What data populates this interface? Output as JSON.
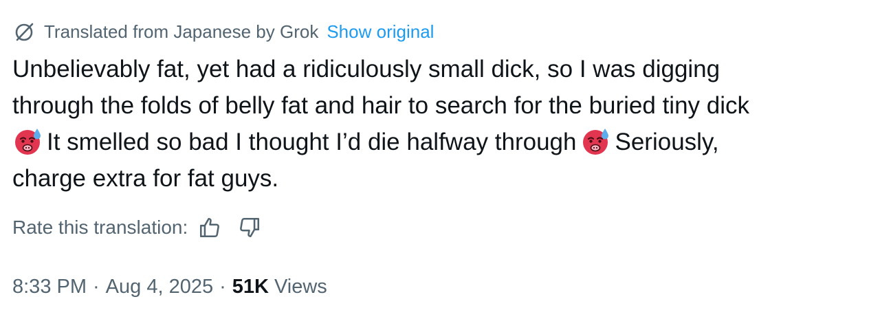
{
  "translation_bar": {
    "label": "Translated from Japanese by Grok",
    "show_original": "Show original",
    "icon": "translate-icon"
  },
  "tweet": {
    "lines": [
      "Unbelievably fat, yet had a ridiculously small dick, so I was digging",
      "through the folds of belly fat and hair to search for the buried tiny dick",
      "It smelled so bad I thought I’d die halfway through",
      "Seriously,",
      "charge extra for fat guys."
    ],
    "emoji": "face-with-sweat-sick-emoji"
  },
  "rating": {
    "label": "Rate this translation:",
    "thumbs_up_icon": "thumbs-up-icon",
    "thumbs_down_icon": "thumbs-down-icon"
  },
  "meta": {
    "time": "8:33 PM",
    "separator": "·",
    "date": "Aug 4, 2025",
    "views_count": "51K",
    "views_label": "Views"
  },
  "colors": {
    "text": "#0f1419",
    "secondary": "#536471",
    "link": "#1d9bf0",
    "emoji_face": "#e2354f",
    "emoji_sweat": "#5dadec"
  }
}
